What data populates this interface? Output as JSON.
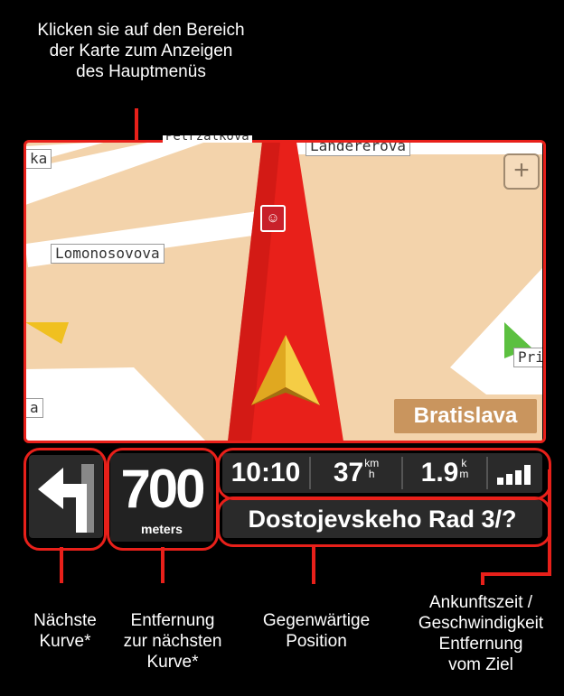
{
  "callouts": {
    "top": [
      "Klicken sie auf den Bereich",
      "der Karte zum Anzeigen",
      "des Hauptmenüs"
    ],
    "next_turn": [
      "Nächste",
      "Kurve*"
    ],
    "distance": [
      "Entfernung",
      "zur nächsten",
      "Kurve*"
    ],
    "position": [
      "Gegenwärtige",
      "Position"
    ],
    "arrival": [
      "Ankunftszeit /",
      "Geschwindigkeit",
      "Entfernung",
      "vom Ziel"
    ]
  },
  "map": {
    "streets": {
      "lomonosovova": "Lomonosovova",
      "landererova": "Landererova",
      "top_left_partial": "Petrzalkova",
      "left_partial": "ka",
      "right_partial": "Prib",
      "bottom_left_partial": "a"
    },
    "city": "Bratislava",
    "zoom_label": "+"
  },
  "nav": {
    "distance_value": "700",
    "distance_unit": "meters",
    "time": "10:10",
    "speed_value": "37",
    "speed_unit_top": "km",
    "speed_unit_bottom": "h",
    "remaining_value": "1.9",
    "remaining_unit_top": "k",
    "remaining_unit_bottom": "m",
    "address": "Dostojevskeho Rad 3/?"
  },
  "colors": {
    "accent": "#e8201a",
    "map_background": "#f3d3ab",
    "route": "#e8201a",
    "city_label": "#c9955e"
  }
}
